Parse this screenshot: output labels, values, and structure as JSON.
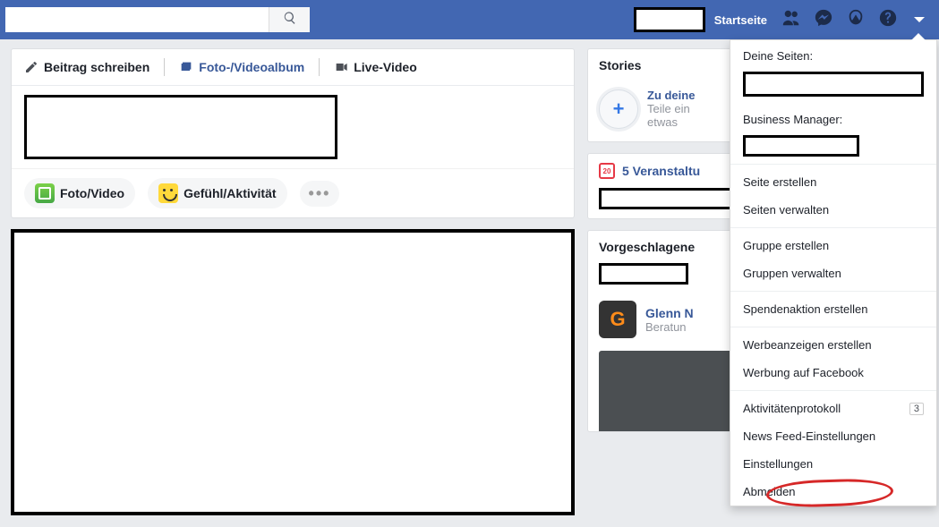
{
  "topbar": {
    "home_label": "Startseite"
  },
  "composer": {
    "tab_post": "Beitrag schreiben",
    "tab_album": "Foto-/Videoalbum",
    "tab_live": "Live-Video",
    "chip_photo": "Foto/Video",
    "chip_feeling": "Gefühl/Aktivität"
  },
  "stories": {
    "title": "Stories",
    "add_title": "Zu deine",
    "add_sub1": "Teile ein",
    "add_sub2": "etwas"
  },
  "events": {
    "label": "5 Veranstaltu"
  },
  "suggested": {
    "title": "Vorgeschlagene",
    "item": {
      "name": "Glenn N",
      "sub": "Beratun"
    }
  },
  "dropdown": {
    "your_pages": "Deine Seiten:",
    "business_manager": "Business Manager:",
    "items_a": [
      "Seite erstellen",
      "Seiten verwalten"
    ],
    "items_b": [
      "Gruppe erstellen",
      "Gruppen verwalten"
    ],
    "items_c": [
      "Spendenaktion erstellen"
    ],
    "items_d": [
      "Werbeanzeigen erstellen",
      "Werbung auf Facebook"
    ],
    "activity_log": "Aktivitätenprotokoll",
    "activity_badge": "3",
    "newsfeed_settings": "News Feed-Einstellungen",
    "settings": "Einstellungen",
    "logout": "Abmelden"
  }
}
